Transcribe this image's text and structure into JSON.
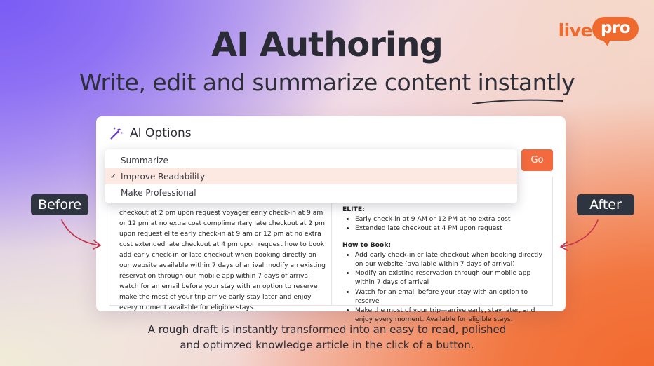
{
  "brand": {
    "logo_live": "live",
    "logo_pro": "pro",
    "accent_color": "#f06a2e"
  },
  "heading": {
    "title": "AI Authoring",
    "subtitle": "Write, edit and summarize content instantly"
  },
  "panel": {
    "title": "AI Options",
    "go_label": "Go",
    "dropdown": {
      "items": [
        {
          "label": "Summarize",
          "selected": false
        },
        {
          "label": "Improve Readability",
          "selected": true
        },
        {
          "label": "Make Professional",
          "selected": false
        }
      ]
    },
    "before_text": "checkout at 2 pm upon request voyager early check-in at 9 am or 12 pm at no extra cost complimentary late checkout at 2 pm upon request elite early check-in at 9 am or 12 pm at no extra cost extended late checkout at 4 pm upon request how to book add early check-in or late checkout when booking directly on our website available within 7 days of arrival modify an existing reservation through our mobile app within 7 days of arrival watch for an email before your stay with an option to reserve make the most of your trip arrive early stay later and enjoy every moment available for eligible stays.",
    "after": {
      "sections": [
        {
          "heading": "ELITE:",
          "bullets": [
            "Early check-in at 9 AM or 12 PM at no extra cost",
            "Extended late checkout at 4 PM upon request"
          ]
        },
        {
          "heading": "How to Book:",
          "bullets": [
            "Add early check-in or late checkout when booking directly on our website (available within 7 days of arrival)",
            "Modify an existing reservation through our mobile app within 7 days of arrival",
            "Watch for an email before your stay with an option to reserve",
            "Make the most of your trip—arrive early, stay later, and enjoy every moment. Available for eligible stays."
          ]
        }
      ]
    }
  },
  "labels": {
    "before": "Before",
    "after": "After"
  },
  "caption": {
    "line1": "A rough draft is instantly transformed into an easy to read, polished",
    "line2": "and optimzed knowledge article in the click of a button."
  }
}
